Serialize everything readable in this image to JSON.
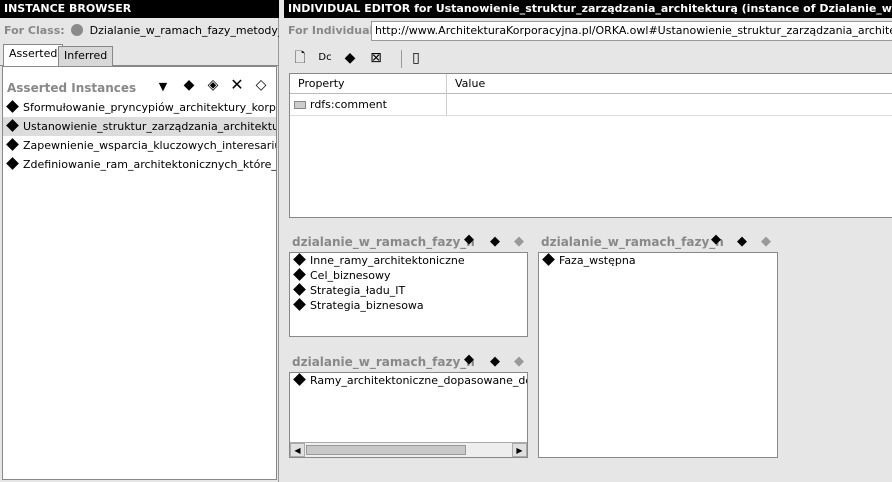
{
  "instance_browser": {
    "title": "INSTANCE BROWSER",
    "for_class_label": "For Class:",
    "for_class_value": "Dzialanie_w_ramach_fazy_metody_tw...",
    "tabs": [
      {
        "label": "Asserted",
        "active": true
      },
      {
        "label": "Inferred",
        "active": false
      }
    ],
    "list_title": "Asserted Instances",
    "instances": [
      {
        "label": "Sformułowanie_pryncypiów_architektury_korporacyj"
      },
      {
        "label": "Ustanowienie_struktur_zarządzania_architekturą",
        "selected": true
      },
      {
        "label": "Zapewnienie_wsparcia_kluczowych_interesariuszy_d"
      },
      {
        "label": "Zdefiniowanie_ram_architektonicznych_które_będą_"
      }
    ]
  },
  "individual_editor": {
    "title": "INDIVIDUAL EDITOR for Ustanowienie_struktur_zarządzania_architekturą   (instance of Dzialanie_w_ramac",
    "for_individual_label": "For Individual:",
    "for_individual_value": "http://www.ArchitekturaKorporacyjna.pl/ORKA.owl#Ustanowienie_struktur_zarządzania_architekturą",
    "table": {
      "col_property": "Property",
      "col_value": "Value",
      "rows": [
        {
          "property": "rdfs:comment",
          "value": ""
        }
      ]
    },
    "slots": [
      {
        "title": "dzialanie_w_ramach_fazy_n",
        "values": [
          "Inne_ramy_architektoniczne",
          "Cel_biznesowy",
          "Strategia_ładu_IT",
          "Strategia_biznesowa"
        ]
      },
      {
        "title": "dzialanie_w_ramach_fazy_n",
        "values": [
          "Faza_wstępna"
        ]
      },
      {
        "title": "dzialanie_w_ramach_fazy_n",
        "values": [
          "Ramy_architektoniczne_dopasowane_do_potr"
        ]
      }
    ]
  }
}
